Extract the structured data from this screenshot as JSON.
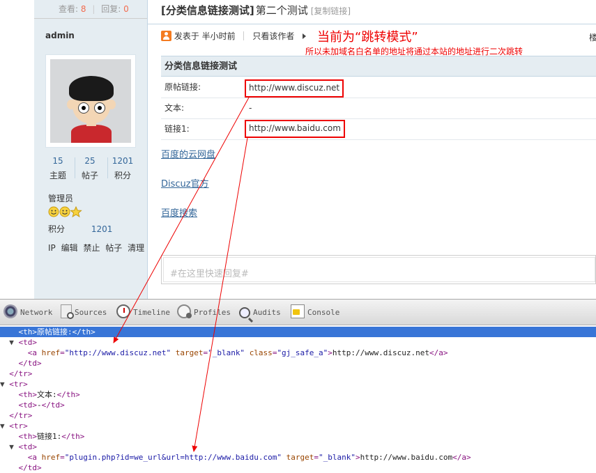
{
  "thread": {
    "views_label": "查看:",
    "views": "8",
    "replies_label": "回复:",
    "replies": "0",
    "title": "[分类信息链接测试]",
    "title2": "第二个测试",
    "copy_link": "[复制链接]"
  },
  "author": {
    "name": "admin",
    "topics": "15",
    "topics_label": "主题",
    "posts": "25",
    "posts_label": "帖子",
    "credits": "1201",
    "credits_label": "积分",
    "role": "管理员",
    "credit_row_label": "积分",
    "credit_row_value": "1201",
    "actions": [
      "IP",
      "编辑",
      "禁止",
      "帖子",
      "清理"
    ]
  },
  "post_meta": {
    "posted": "发表于 半小时前",
    "only_author": "只看该作者",
    "floor_fragment": "楼"
  },
  "annotation": {
    "title": "当前为“跳转模式”",
    "subtitle": "所以未加域名白名单的地址将通过本站的地址进行二次跳转"
  },
  "info_table": {
    "heading": "分类信息链接测试",
    "rows": [
      {
        "label": "原帖链接:",
        "value": "http://www.discuz.net"
      },
      {
        "label": "文本:",
        "value": "-"
      },
      {
        "label": "链接1:",
        "value": "http://www.baidu.com"
      }
    ]
  },
  "links": [
    "百度的云网盘",
    "Discuz官方",
    "百度搜索"
  ],
  "quick_reply": {
    "placeholder": "#在这里快速回复#"
  },
  "devtools": {
    "tabs": [
      {
        "label": "Network",
        "icon": "network-icon"
      },
      {
        "label": "Sources",
        "icon": "sources-icon"
      },
      {
        "label": "Timeline",
        "icon": "timeline-icon"
      },
      {
        "label": "Profiles",
        "icon": "profiles-icon"
      },
      {
        "label": "Audits",
        "icon": "audits-icon"
      },
      {
        "label": "Console",
        "icon": "console-icon"
      }
    ],
    "code": {
      "l0": "    <th>原帖链接:</th>",
      "l1_open": "<td>",
      "l2_tag_open": "<a ",
      "l2_href_attr": "href",
      "l2_href_val": "\"http://www.discuz.net\"",
      "l2_target_attr": "target",
      "l2_target_val": "\"_blank\"",
      "l2_class_attr": "class",
      "l2_class_val": "\"gj_safe_a\"",
      "l2_text": "http://www.discuz.net",
      "l2_close": "</a>",
      "l3": "</td>",
      "l4": "</tr>",
      "l5": "<tr>",
      "l6_th_open": "<th>",
      "l6_text": "文本:",
      "l6_th_close": "</th>",
      "l7_td_open": "<td>",
      "l7_text": "-",
      "l7_td_close": "</td>",
      "l8": "</tr>",
      "l9": "<tr>",
      "l10_th_open": "<th>",
      "l10_text": "链接1:",
      "l10_th_close": "</th>",
      "l11": "<td>",
      "l12_href_val": "\"plugin.php?id=we_url&url=http://www.baidu.com\"",
      "l12_text": "http://www.baidu.com",
      "l13": "</td>"
    }
  },
  "colors": {
    "annotation": "#ee0000",
    "link": "#336699",
    "sidebar_bg": "#e5edf2",
    "devtools_selection": "#3875d7"
  }
}
